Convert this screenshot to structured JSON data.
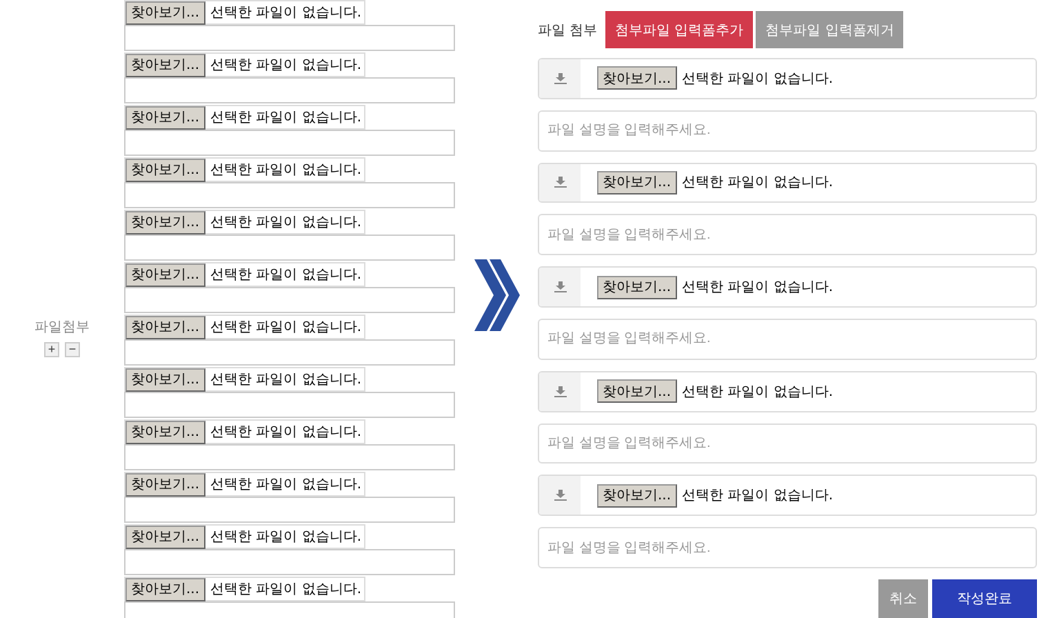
{
  "left_form": {
    "label": "파일첨부",
    "add_button": "+",
    "remove_button": "−",
    "rows": [
      {
        "browse": "찾아보기...",
        "status": "선택한 파일이 없습니다."
      },
      {
        "browse": "찾아보기...",
        "status": "선택한 파일이 없습니다."
      },
      {
        "browse": "찾아보기...",
        "status": "선택한 파일이 없습니다."
      },
      {
        "browse": "찾아보기...",
        "status": "선택한 파일이 없습니다."
      },
      {
        "browse": "찾아보기...",
        "status": "선택한 파일이 없습니다."
      },
      {
        "browse": "찾아보기...",
        "status": "선택한 파일이 없습니다."
      },
      {
        "browse": "찾아보기...",
        "status": "선택한 파일이 없습니다."
      },
      {
        "browse": "찾아보기...",
        "status": "선택한 파일이 없습니다."
      },
      {
        "browse": "찾아보기...",
        "status": "선택한 파일이 없습니다."
      },
      {
        "browse": "찾아보기...",
        "status": "선택한 파일이 없습니다."
      },
      {
        "browse": "찾아보기...",
        "status": "선택한 파일이 없습니다."
      },
      {
        "browse": "찾아보기...",
        "status": "선택한 파일이 없습니다."
      }
    ]
  },
  "right_form": {
    "label": "파일 첨부",
    "add_button": "첨부파일 입력폼추가",
    "remove_button": "첨부파일 입력폼제거",
    "rows": [
      {
        "browse": "찾아보기...",
        "status": "선택한 파일이 없습니다.",
        "placeholder": "파일 설명을 입력해주세요."
      },
      {
        "browse": "찾아보기...",
        "status": "선택한 파일이 없습니다.",
        "placeholder": "파일 설명을 입력해주세요."
      },
      {
        "browse": "찾아보기...",
        "status": "선택한 파일이 없습니다.",
        "placeholder": "파일 설명을 입력해주세요."
      },
      {
        "browse": "찾아보기...",
        "status": "선택한 파일이 없습니다.",
        "placeholder": "파일 설명을 입력해주세요."
      },
      {
        "browse": "찾아보기...",
        "status": "선택한 파일이 없습니다.",
        "placeholder": "파일 설명을 입력해주세요."
      }
    ],
    "cancel_button": "취소",
    "submit_button": "작성완료"
  }
}
